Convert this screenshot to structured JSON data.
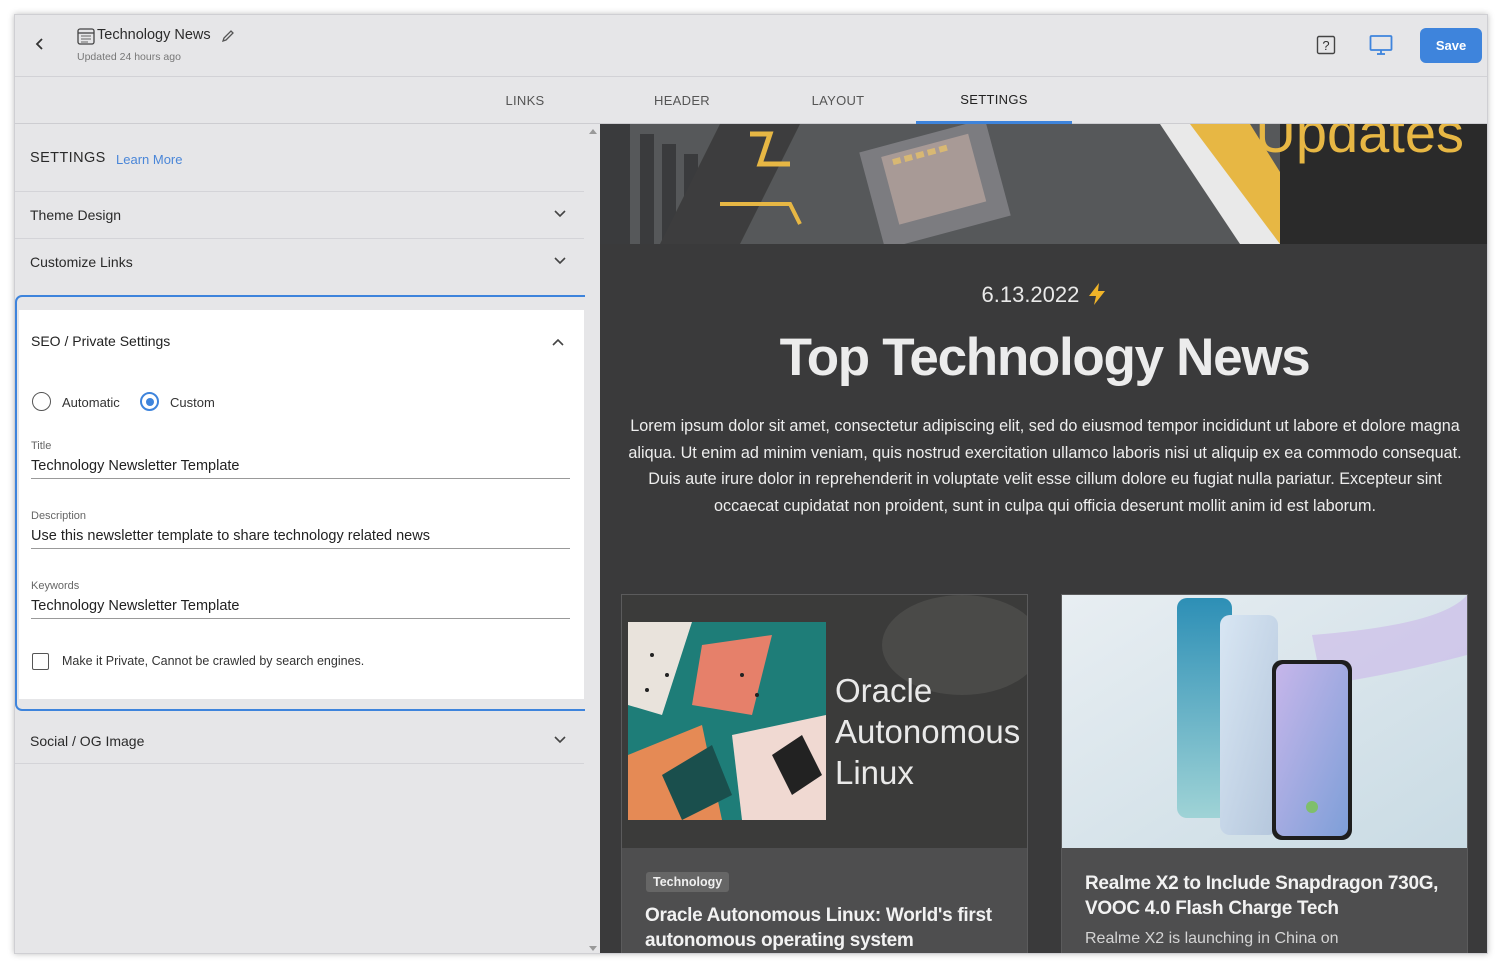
{
  "topbar": {
    "doc_title": "Technology News",
    "updated": "Updated 24 hours ago",
    "save_label": "Save"
  },
  "tabs": [
    {
      "label": "LINKS"
    },
    {
      "label": "HEADER"
    },
    {
      "label": "LAYOUT"
    },
    {
      "label": "SETTINGS",
      "active": true
    }
  ],
  "settings": {
    "header": "SETTINGS",
    "learn_more": "Learn More",
    "sections": {
      "theme_design": "Theme Design",
      "customize_links": "Customize Links",
      "seo": "SEO / Private Settings",
      "social": "Social / OG Image"
    },
    "seo": {
      "mode_automatic": "Automatic",
      "mode_custom": "Custom",
      "selected_mode": "Custom",
      "title_label": "Title",
      "title_value": "Technology Newsletter Template",
      "description_label": "Description",
      "description_value": "Use this newsletter template to share technology related news",
      "keywords_label": "Keywords",
      "keywords_value": "Technology Newsletter Template",
      "private_label": "Make it Private, Cannot be crawled by search engines.",
      "private_checked": false
    }
  },
  "preview": {
    "hero_text": "Updates",
    "date": "6.13.2022",
    "date_icon": "lightning-icon",
    "headline": "Top Technology News",
    "body": "Lorem ipsum dolor sit amet, consectetur adipiscing elit, sed do eiusmod tempor incididunt ut labore et dolore magna aliqua. Ut enim ad minim veniam, quis nostrud exercitation ullamco laboris nisi ut aliquip ex ea commodo consequat. Duis aute irure dolor in reprehenderit in voluptate velit esse cillum dolore eu fugiat nulla pariatur. Excepteur sint occaecat cupidatat non proident, sunt in culpa qui officia deserunt mollit anim id est laborum.",
    "cards": [
      {
        "image_text_1": "Oracle",
        "image_text_2": "Autonomous",
        "image_text_3": "Linux",
        "badge": "Technology",
        "title": "Oracle Autonomous Linux: World's first autonomous operating system"
      },
      {
        "title": "Realme X2 to Include Snapdragon 730G, VOOC 4.0 Flash Charge Tech",
        "description": "Realme X2 is launching in China on"
      }
    ]
  },
  "colors": {
    "accent": "#3e84dc",
    "hero_text": "#e7b744",
    "preview_bg": "#3a3a3b"
  }
}
